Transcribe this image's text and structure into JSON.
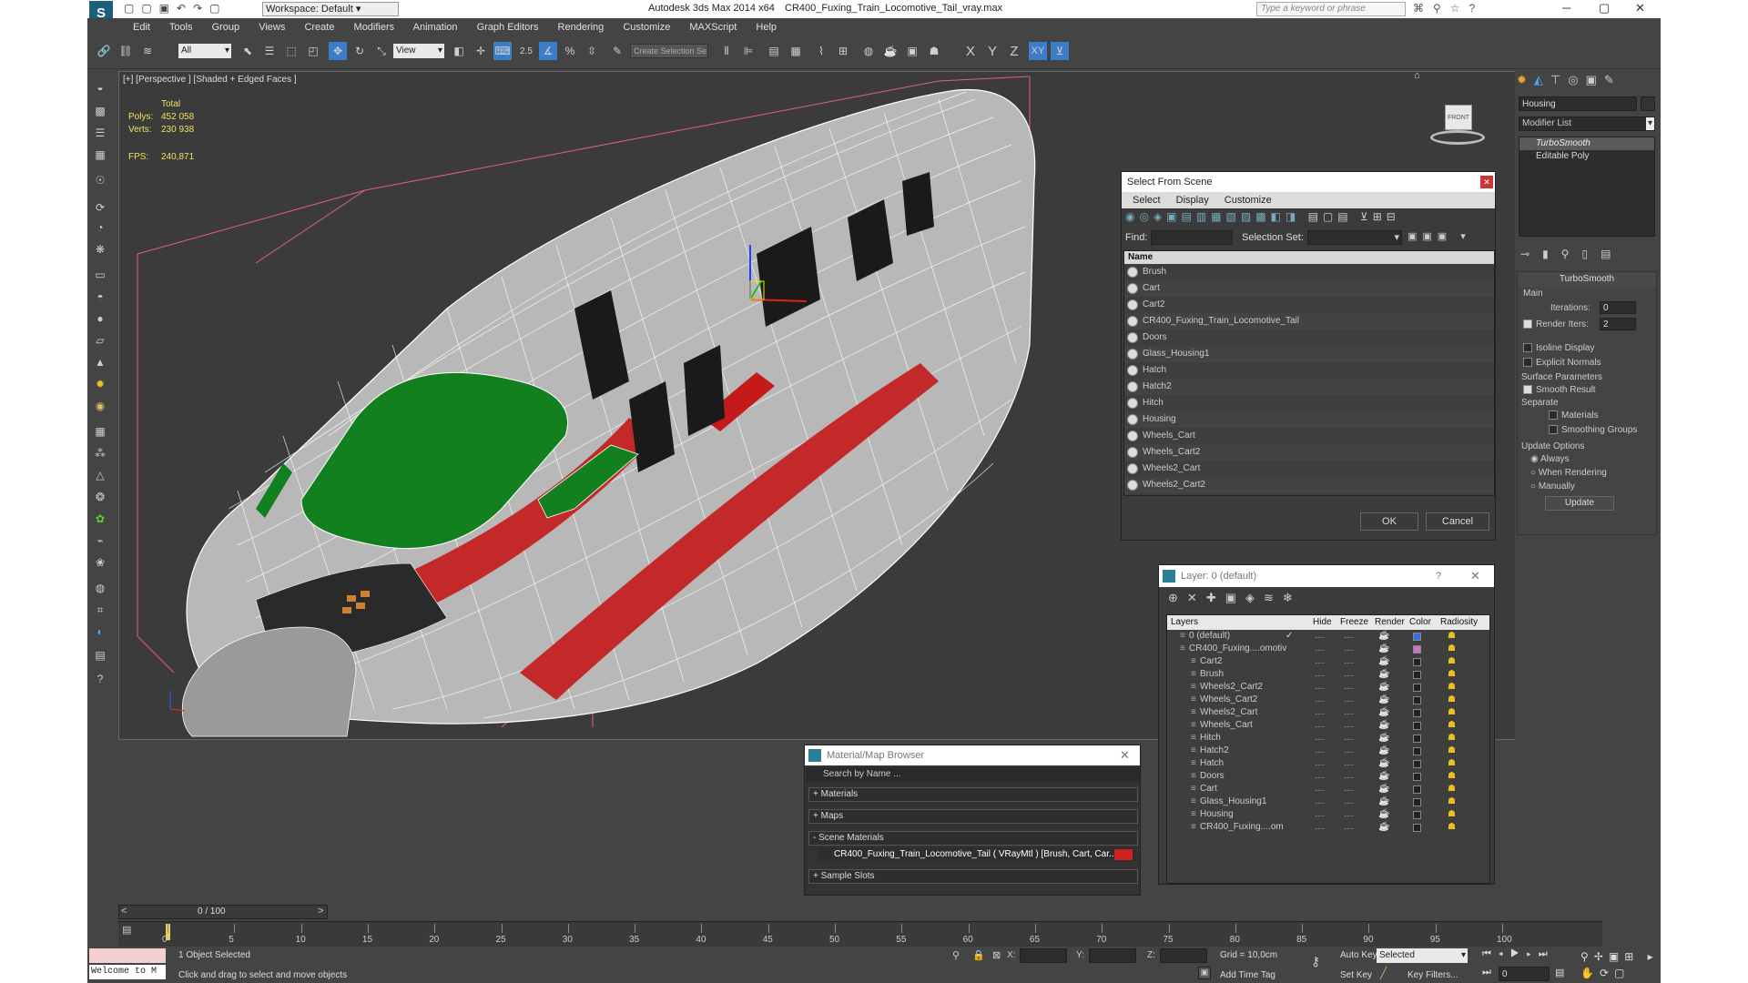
{
  "titlebar": {
    "workspace": "Workspace: Default",
    "app_title": "Autodesk 3ds Max  2014 x64",
    "file_name": "CR400_Fuxing_Train_Locomotive_Tail_vray.max",
    "search_placeholder": "Type a keyword or phrase"
  },
  "menu": [
    "Edit",
    "Tools",
    "Group",
    "Views",
    "Create",
    "Modifiers",
    "Animation",
    "Graph Editors",
    "Rendering",
    "Customize",
    "MAXScript",
    "Help"
  ],
  "toolbar": {
    "selection_filter": "All",
    "ref_coord": "View",
    "snap_value": "2.5",
    "named_selection_placeholder": "Create Selection Se",
    "axes": [
      "X",
      "Y",
      "Z",
      "XY"
    ]
  },
  "viewport": {
    "label": "[+] [Perspective ] [Shaded + Edged Faces ]",
    "stats": {
      "total_label": "Total",
      "polys_label": "Polys:",
      "polys": "452 058",
      "verts_label": "Verts:",
      "verts": "230 938",
      "fps_label": "FPS:",
      "fps": "240,871"
    },
    "viewcube_label": "FRONT"
  },
  "select_from_scene": {
    "title": "Select From Scene",
    "menus": [
      "Select",
      "Display",
      "Customize"
    ],
    "find_label": "Find:",
    "selection_set_label": "Selection Set:",
    "column_name": "Name",
    "items": [
      "Brush",
      "Cart",
      "Cart2",
      "CR400_Fuxing_Train_Locomotive_Tail",
      "Doors",
      "Glass_Housing1",
      "Hatch",
      "Hatch2",
      "Hitch",
      "Housing",
      "Wheels_Cart",
      "Wheels_Cart2",
      "Wheels2_Cart",
      "Wheels2_Cart2"
    ],
    "ok": "OK",
    "cancel": "Cancel"
  },
  "layer_manager": {
    "title": "Layer: 0 (default)",
    "help": "?",
    "columns": [
      "Layers",
      "Hide",
      "Freeze",
      "Render",
      "Color",
      "Radiosity"
    ],
    "rows": [
      {
        "name": "0 (default)",
        "level": 0,
        "color": "#3a6fd8"
      },
      {
        "name": "CR400_Fuxing....omotiv",
        "level": 0,
        "color": "#d070d0"
      },
      {
        "name": "Cart2",
        "level": 1,
        "color": "#222222"
      },
      {
        "name": "Brush",
        "level": 1,
        "color": "#222222"
      },
      {
        "name": "Wheels2_Cart2",
        "level": 1,
        "color": "#222222"
      },
      {
        "name": "Wheels_Cart2",
        "level": 1,
        "color": "#222222"
      },
      {
        "name": "Wheels2_Cart",
        "level": 1,
        "color": "#222222"
      },
      {
        "name": "Wheels_Cart",
        "level": 1,
        "color": "#222222"
      },
      {
        "name": "Hitch",
        "level": 1,
        "color": "#222222"
      },
      {
        "name": "Hatch2",
        "level": 1,
        "color": "#222222"
      },
      {
        "name": "Hatch",
        "level": 1,
        "color": "#222222"
      },
      {
        "name": "Doors",
        "level": 1,
        "color": "#222222"
      },
      {
        "name": "Cart",
        "level": 1,
        "color": "#222222"
      },
      {
        "name": "Glass_Housing1",
        "level": 1,
        "color": "#222222"
      },
      {
        "name": "Housing",
        "level": 1,
        "color": "#222222"
      },
      {
        "name": "CR400_Fuxing....om",
        "level": 1,
        "color": "#222222"
      }
    ]
  },
  "material_browser": {
    "title": "Material/Map Browser",
    "search_placeholder": "Search by Name ...",
    "sections": [
      "+ Materials",
      "+ Maps",
      "- Scene Materials",
      "+ Sample Slots"
    ],
    "scene_material": "CR400_Fuxing_Train_Locomotive_Tail  ( VRayMtl ) [Brush, Cart, Car..."
  },
  "command_panel": {
    "object_name": "Housing",
    "modifier_list": "Modifier List",
    "stack": [
      "TurboSmooth",
      "Editable Poly"
    ],
    "rollout_title": "TurboSmooth",
    "main_group": "Main",
    "iterations_label": "Iterations:",
    "iterations": "0",
    "render_iters_label": "Render Iters:",
    "render_iters": "2",
    "isoline": "Isoline Display",
    "explicit_normals": "Explicit Normals",
    "surface_group": "Surface Parameters",
    "smooth_result": "Smooth Result",
    "separate": "Separate",
    "materials": "Materials",
    "smoothing_groups": "Smoothing Groups",
    "update_group": "Update Options",
    "always": "Always",
    "when_rendering": "When Rendering",
    "manually": "Manually",
    "update_btn": "Update"
  },
  "timeline": {
    "frame": "0 / 100",
    "ticks": [
      "0",
      "5",
      "10",
      "15",
      "20",
      "25",
      "30",
      "35",
      "40",
      "45",
      "50",
      "55",
      "60",
      "65",
      "70",
      "75",
      "80",
      "85",
      "90",
      "95",
      "100"
    ]
  },
  "status": {
    "maxscript": "Welcome to M",
    "selected": "1 Object Selected",
    "prompt": "Click and drag to select and move objects",
    "x_label": "X:",
    "y_label": "Y:",
    "z_label": "Z:",
    "grid": "Grid = 10,0cm",
    "add_time_tag": "Add Time Tag",
    "auto_key": "Auto Key",
    "selected_dropdown": "Selected",
    "set_key": "Set Key",
    "key_filters": "Key Filters...",
    "current_frame": "0"
  }
}
